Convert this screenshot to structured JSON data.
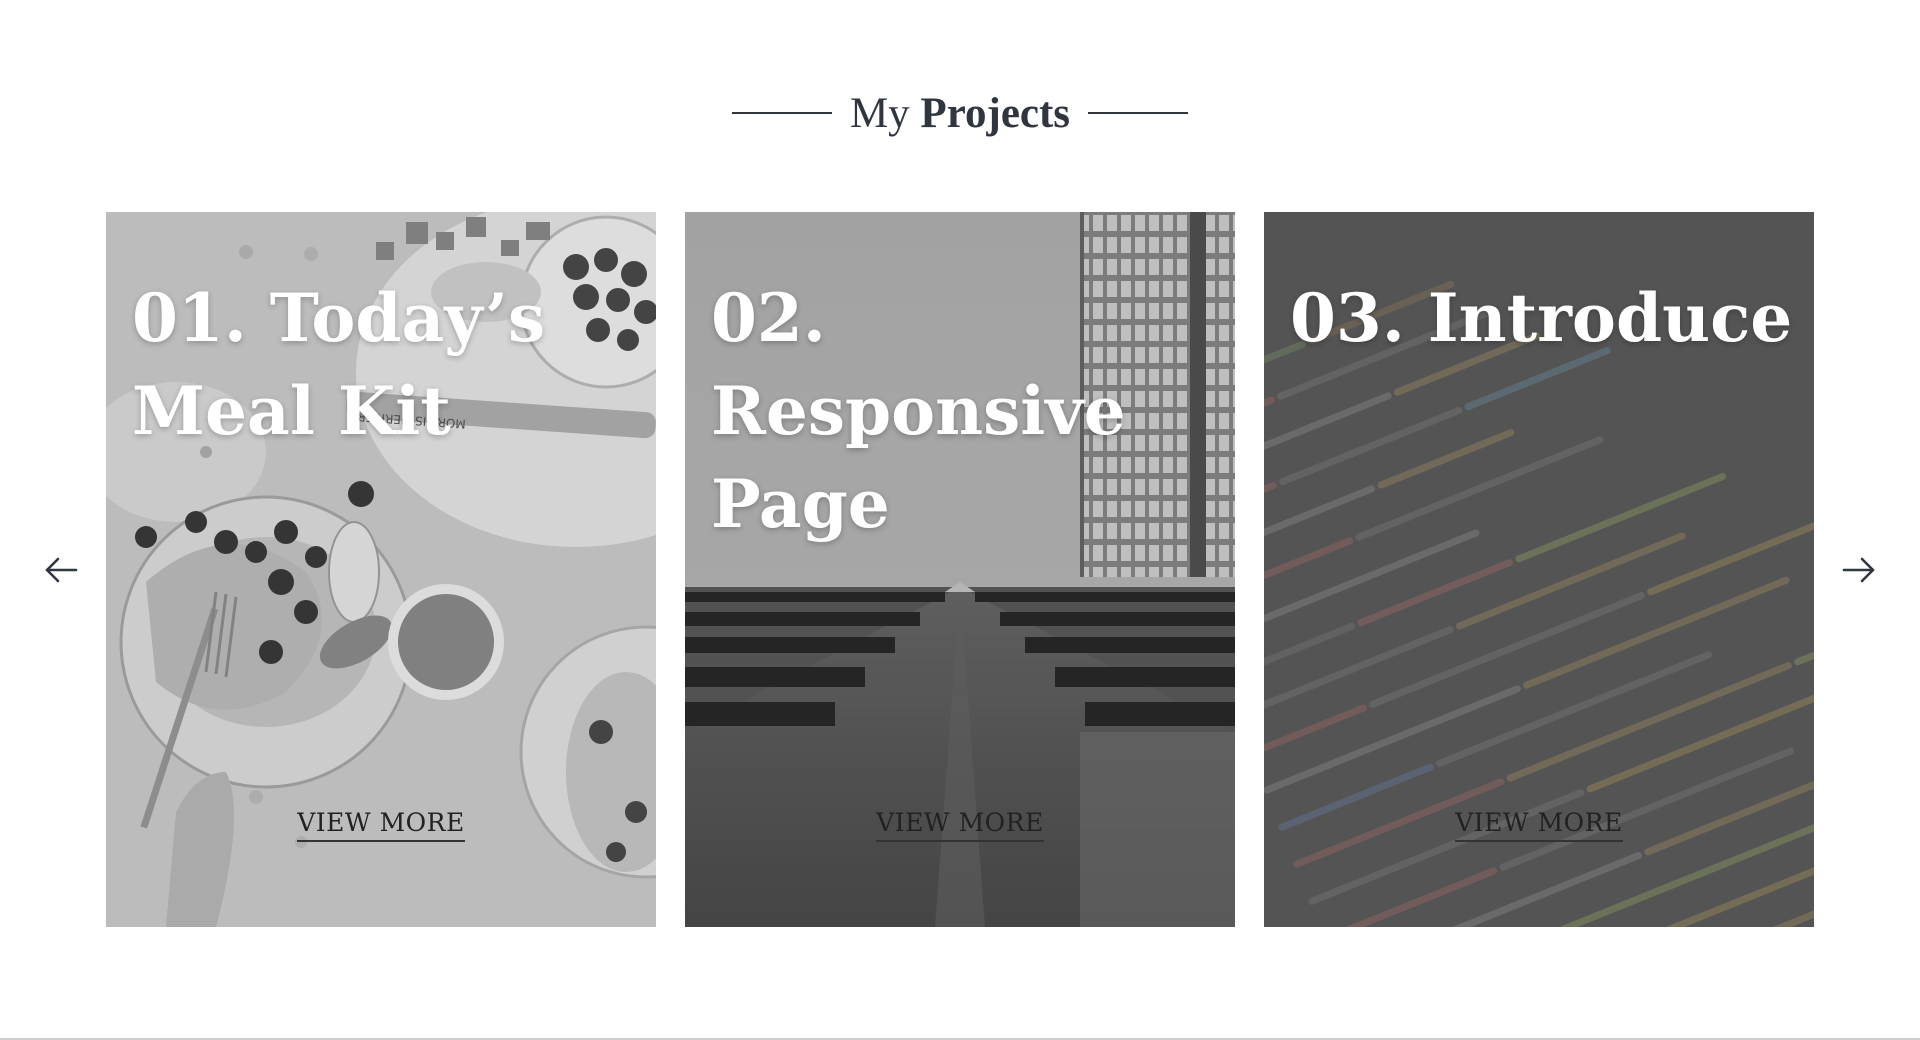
{
  "section": {
    "title_light": "My",
    "title_bold": "Projects"
  },
  "carousel": {
    "prev_icon": "arrow-left-icon",
    "next_icon": "arrow-right-icon"
  },
  "projects": [
    {
      "title": "01. Today’s Meal Kit",
      "cta": "VIEW MORE",
      "image": "breakfast-plates-photo"
    },
    {
      "title": "02. Responsive Page",
      "cta": "VIEW MORE",
      "image": "skyscraper-photo"
    },
    {
      "title": "03. Introduce",
      "cta": "VIEW MORE",
      "image": "code-screen-photo"
    }
  ]
}
